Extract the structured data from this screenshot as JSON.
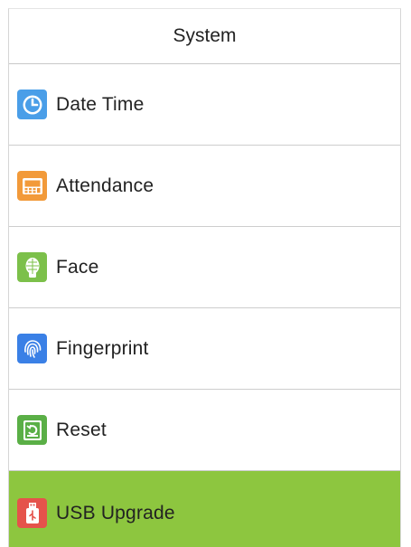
{
  "header": {
    "title": "System"
  },
  "menu": {
    "items": [
      {
        "label": "Date Time",
        "icon": "clock-icon",
        "color": "#4a9ee8"
      },
      {
        "label": "Attendance",
        "icon": "attendance-terminal-icon",
        "color": "#f29a3a"
      },
      {
        "label": "Face",
        "icon": "face-scan-icon",
        "color": "#7cc04a"
      },
      {
        "label": "Fingerprint",
        "icon": "fingerprint-icon",
        "color": "#3a80e6"
      },
      {
        "label": "Reset",
        "icon": "reset-icon",
        "color": "#5aaf46"
      },
      {
        "label": "USB Upgrade",
        "icon": "usb-icon",
        "color": "#e5534b",
        "selected": true
      }
    ],
    "selected_color": "#8dc63f"
  }
}
